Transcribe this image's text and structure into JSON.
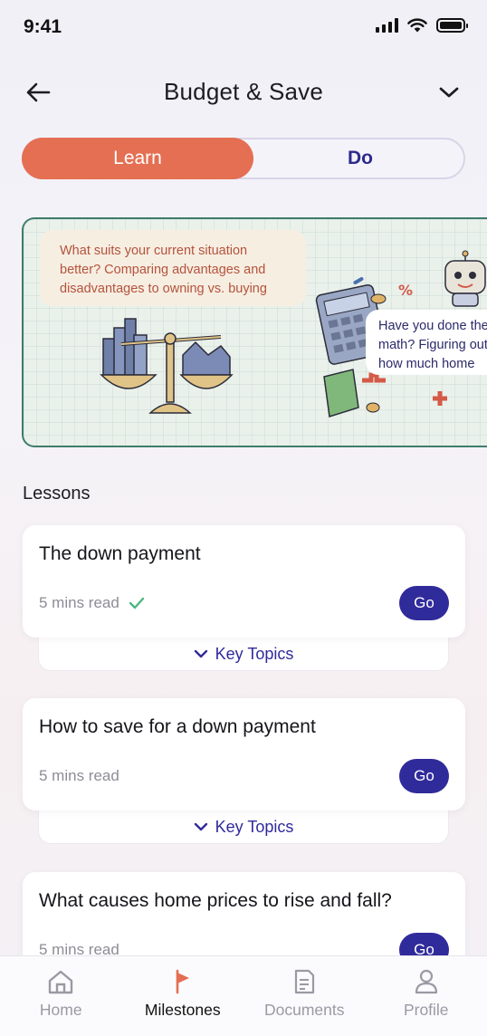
{
  "status_bar": {
    "time": "9:41"
  },
  "header": {
    "title": "Budget & Save"
  },
  "tabs": [
    {
      "label": "Learn",
      "active": true
    },
    {
      "label": "Do",
      "active": false
    }
  ],
  "banner": {
    "cards": [
      {
        "text": "What suits your current situation better? Comparing advantages and disadvantages to owning vs. buying"
      },
      {
        "text": "Have you done the math? Figuring out how much home you can afford"
      }
    ]
  },
  "lessons": {
    "heading": "Lessons",
    "items": [
      {
        "title": "The down payment",
        "meta": "5 mins read",
        "completed": true,
        "go_label": "Go",
        "key_topics_label": "Key Topics"
      },
      {
        "title": "How to save for a down payment",
        "meta": "5 mins read",
        "completed": false,
        "go_label": "Go",
        "key_topics_label": "Key Topics"
      },
      {
        "title": "What causes home prices to rise and fall?",
        "meta": "5 mins read",
        "completed": false,
        "go_label": "Go"
      }
    ]
  },
  "bottom_nav": [
    {
      "label": "Home",
      "icon": "home-icon",
      "active": false
    },
    {
      "label": "Milestones",
      "icon": "flag-icon",
      "active": true
    },
    {
      "label": "Documents",
      "icon": "document-icon",
      "active": false
    },
    {
      "label": "Profile",
      "icon": "profile-icon",
      "active": false
    }
  ],
  "colors": {
    "accent": "#e46f52",
    "primary": "#302b9b",
    "banner_border": "#3f7d6b",
    "check": "#4cb782"
  }
}
